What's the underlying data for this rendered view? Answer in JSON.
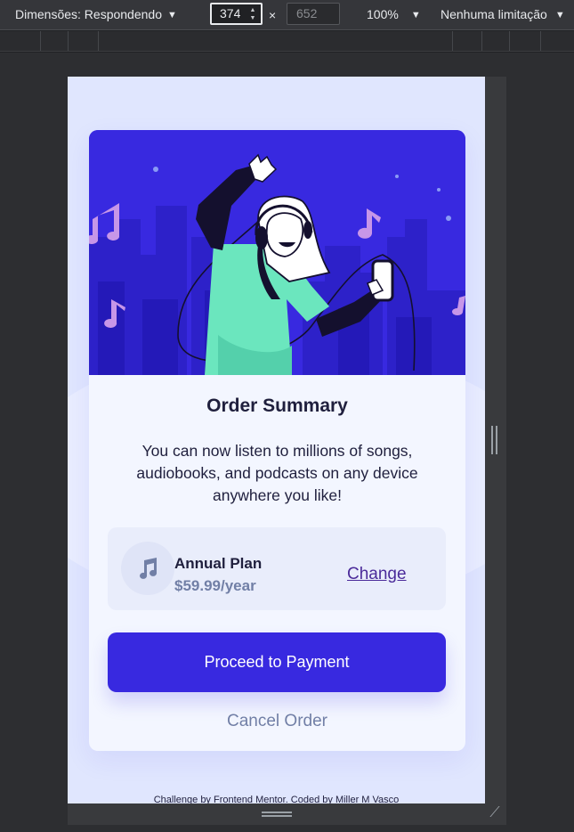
{
  "toolbar": {
    "dimensions_label": "Dimensões: Respondendo",
    "width_value": "374",
    "times": "×",
    "height_value": "652",
    "zoom_label": "100%",
    "throttle_label": "Nenhuma limitação"
  },
  "card": {
    "title": "Order Summary",
    "description": "You can now listen to millions of songs, audiobooks, and podcasts on any device anywhere you like!",
    "plan": {
      "name": "Annual Plan",
      "price": "$59.99/year",
      "change_label": "Change"
    },
    "proceed_label": "Proceed to Payment",
    "cancel_label": "Cancel Order"
  },
  "footer": {
    "text": "Challenge by Frontend Mentor. Coded by Miller M Vasco"
  },
  "colors": {
    "accent": "#3829e0",
    "pale_blue": "#e0e6fe",
    "dark_blue": "#1f1f3d",
    "desaturated_blue": "#717fa6"
  },
  "icons": [
    "chevron-down-icon",
    "spin-up-icon",
    "spin-down-icon",
    "music-note-icon",
    "resize-corner-icon"
  ]
}
